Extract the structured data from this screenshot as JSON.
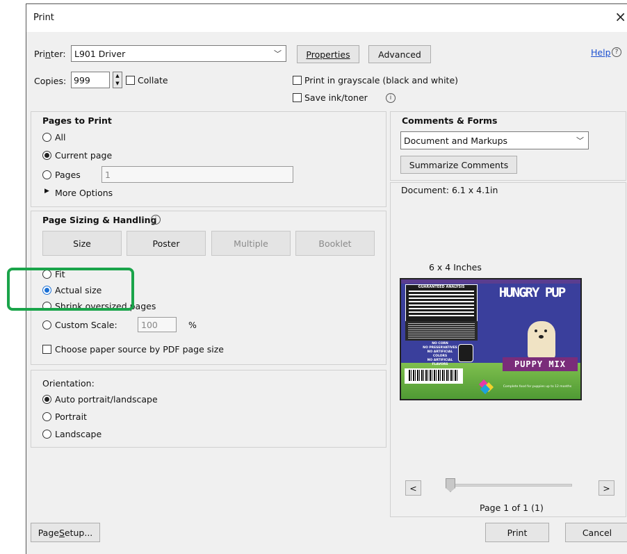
{
  "window": {
    "title": "Print",
    "close": "×"
  },
  "printer": {
    "label": "Printer:",
    "value": "L901 Driver",
    "properties": "Properties",
    "advanced": "Advanced"
  },
  "help": {
    "label": "Help",
    "icon": "?"
  },
  "copies": {
    "label": "Copies:",
    "value": "999",
    "collate": "Collate"
  },
  "options": {
    "grayscale": "Print in grayscale (black and white)",
    "save_ink": "Save ink/toner"
  },
  "pages_to_print": {
    "title": "Pages to Print",
    "all": "All",
    "current": "Current page",
    "pages": "Pages",
    "pages_value": "1",
    "more": "More Options"
  },
  "sizing": {
    "title": "Page Sizing & Handling",
    "tabs": [
      "Size",
      "Poster",
      "Multiple",
      "Booklet"
    ],
    "fit": "Fit",
    "actual": "Actual size",
    "shrink": "Shrink oversized pages",
    "custom": "Custom Scale:",
    "custom_value": "100",
    "percent": "%",
    "paper_source": "Choose paper source by PDF page size"
  },
  "orientation": {
    "title": "Orientation:",
    "auto": "Auto portrait/landscape",
    "portrait": "Portrait",
    "landscape": "Landscape"
  },
  "comments": {
    "title": "Comments & Forms",
    "value": "Document and Markups",
    "summarize": "Summarize Comments"
  },
  "document_info": "Document: 6.1 x 4.1in",
  "preview": {
    "size_label": "6 x 4 Inches",
    "brand": "HUNGRY PUP",
    "subtitle": "PUPPY MIX",
    "table_title": "GUARANTEED ANALYSIS",
    "badges": "NO CORN\nNO PRESERVATIVES\nNO ARTIFICIAL COLORS\nNO ARTIFICIAL FLAVORS",
    "bottom_text": "Complete food for puppies up to 12 months"
  },
  "pager": {
    "prev": "<",
    "next": ">",
    "label": "Page 1 of 1 (1)"
  },
  "footer": {
    "setup": "Page Setup...",
    "print": "Print",
    "cancel": "Cancel"
  }
}
